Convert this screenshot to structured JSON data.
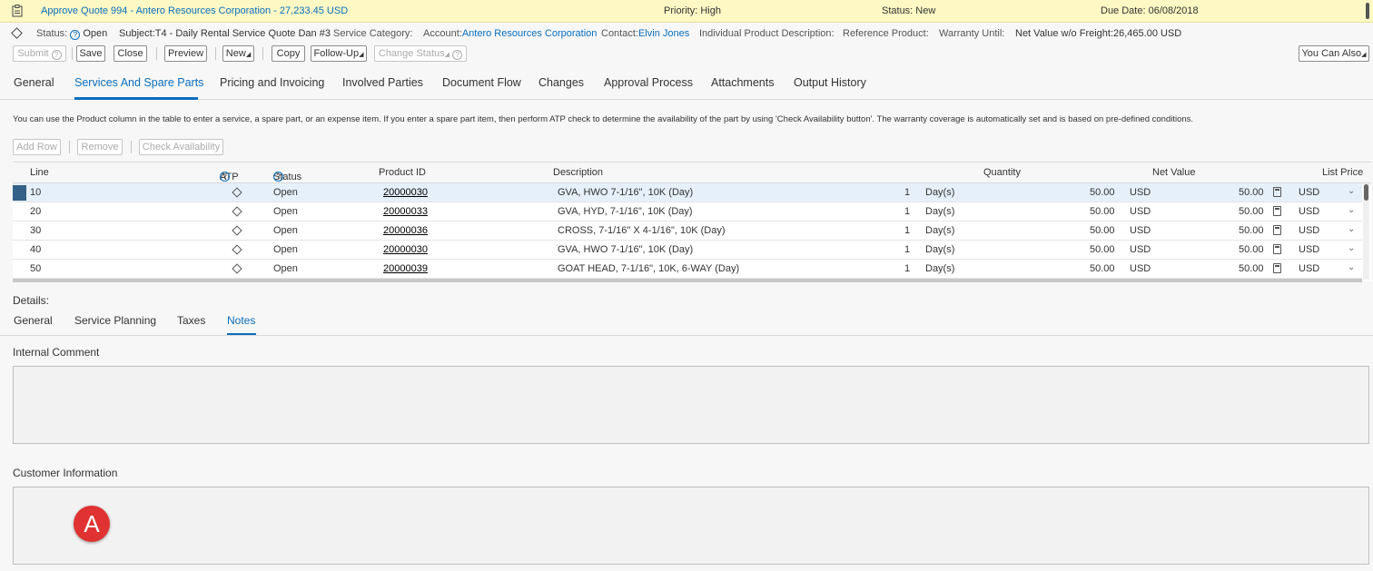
{
  "alert": {
    "title": "Approve Quote 994 - Antero Resources Corporation - 27,233.45 USD",
    "priority": "Priority: High",
    "status": "Status: New",
    "due": "Due Date: 06/08/2018"
  },
  "meta": {
    "status_label": "Status:",
    "status_value": "Open",
    "subject": "Subject:T4 - Daily Rental Service Quote Dan #3",
    "service_category": "Service Category:",
    "account_label": "Account:",
    "account_value": "Antero Resources Corporation",
    "contact_label": "Contact:",
    "contact_value": "Elvin Jones",
    "ind_product": "Individual Product Description:",
    "ref_product": "Reference Product:",
    "warranty": "Warranty Until:",
    "net_value": "Net Value w/o Freight:26,465.00 USD"
  },
  "toolbar": {
    "submit": "Submit",
    "save": "Save",
    "close": "Close",
    "preview": "Preview",
    "new": "New",
    "copy": "Copy",
    "follow_up": "Follow-Up",
    "change_status": "Change Status",
    "you_can_also": "You Can Also"
  },
  "tabs": [
    "General",
    "Services And Spare Parts",
    "Pricing and Invoicing",
    "Involved Parties",
    "Document Flow",
    "Changes",
    "Approval Process",
    "Attachments",
    "Output History"
  ],
  "info_text": "You can use the Product column in the table to enter a service, a spare part, or an expense item. If you enter a spare part item, then perform ATP check to determine the availability of the part by using 'Check Availability button'. The warranty coverage is automatically set and is based on pre-defined conditions.",
  "table_toolbar": {
    "add_row": "Add Row",
    "remove": "Remove",
    "check_availability": "Check Availability"
  },
  "columns": {
    "line": "Line",
    "atp": "ATP",
    "status": "Status",
    "product_id": "Product ID",
    "description": "Description",
    "quantity": "Quantity",
    "net_value": "Net Value",
    "list_price": "List Price"
  },
  "rows": [
    {
      "line": "10",
      "status": "Open",
      "product_id": "20000030",
      "description": "GVA, HWO 7-1/16\", 10K (Day)",
      "qty": "1",
      "unit": "Day(s)",
      "net": "50.00",
      "net_cur": "USD",
      "list": "50.00",
      "list_cur": "USD"
    },
    {
      "line": "20",
      "status": "Open",
      "product_id": "20000033",
      "description": "GVA, HYD, 7-1/16\", 10K (Day)",
      "qty": "1",
      "unit": "Day(s)",
      "net": "50.00",
      "net_cur": "USD",
      "list": "50.00",
      "list_cur": "USD"
    },
    {
      "line": "30",
      "status": "Open",
      "product_id": "20000036",
      "description": "CROSS, 7-1/16\" X 4-1/16\", 10K (Day)",
      "qty": "1",
      "unit": "Day(s)",
      "net": "50.00",
      "net_cur": "USD",
      "list": "50.00",
      "list_cur": "USD"
    },
    {
      "line": "40",
      "status": "Open",
      "product_id": "20000030",
      "description": "GVA, HWO 7-1/16\", 10K (Day)",
      "qty": "1",
      "unit": "Day(s)",
      "net": "50.00",
      "net_cur": "USD",
      "list": "50.00",
      "list_cur": "USD"
    },
    {
      "line": "50",
      "status": "Open",
      "product_id": "20000039",
      "description": "GOAT HEAD, 7-1/16\", 10K, 6-WAY (Day)",
      "qty": "1",
      "unit": "Day(s)",
      "net": "50.00",
      "net_cur": "USD",
      "list": "50.00",
      "list_cur": "USD"
    }
  ],
  "details": {
    "label": "Details:",
    "tabs": [
      "General",
      "Service Planning",
      "Taxes",
      "Notes"
    ],
    "internal_comment": "Internal Comment",
    "customer_information": "Customer Information"
  },
  "annotation_marker": "A"
}
